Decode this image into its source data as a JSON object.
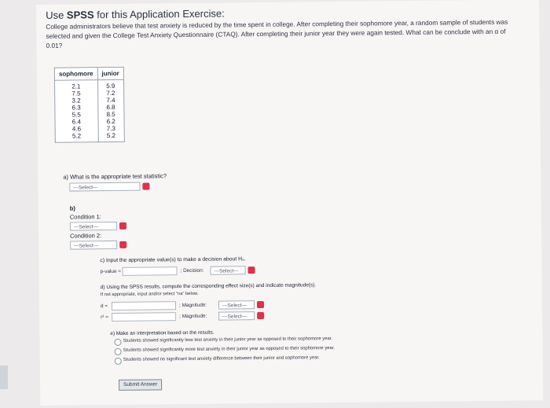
{
  "header": {
    "title_prefix": "Use",
    "title_strong": "SPSS",
    "title_suffix": " for this Application Exercise:"
  },
  "intro": "College administrators believe that test anxiety is reduced by the time spent in college. After completing their sophomore year, a random sample of students was selected and given the College Test Anxiety Questionnaire (CTAQ). After completing their junior year they were again tested. What can be conclude with an α of 0.01?",
  "table": {
    "headers": [
      "sophomore",
      "junior"
    ],
    "sophomore": [
      "2.1",
      "7.5",
      "3.2",
      "6.3",
      "5.5",
      "6.4",
      "4.6",
      "5.2"
    ],
    "junior": [
      "5.9",
      "7.2",
      "7.4",
      "6.8",
      "8.5",
      "6.2",
      "7.3",
      "5.2"
    ]
  },
  "qa": {
    "label": "a) What is the appropriate test statistic?",
    "select": "---Select---"
  },
  "qb": {
    "label": "b)",
    "cond1": "Condition 1:",
    "cond1_select": "---Select---",
    "cond2": "Condition 2:",
    "cond2_select": "---Select---"
  },
  "qc": {
    "label": "c) Input the appropriate value(s) to make a decision about H₀.",
    "pvalue": "p-value =",
    "decision": "; Decision:",
    "select": "---Select---"
  },
  "qd": {
    "label": "d) Using the SPSS results, compute the corresponding effect size(s) and indicate magnitude(s).",
    "note": "If not appropriate, input and/or select \"na\" below.",
    "d": "d =",
    "r2": "r² =",
    "mag1": "; Magnitude:",
    "mag2": "; Magnitude:",
    "select": "---Select---"
  },
  "qe": {
    "label": "e) Make an interpretation based on the results.",
    "opt1": "Students showed significantly less test anxiety in their junior year as opposed to their sophomore year.",
    "opt2": "Students showed significantly more test anxiety in their junior year as opposed to their sophomore year.",
    "opt3": "Students showed no significant test anxiety difference between their junior and sophomore year."
  },
  "submit": "Submit Answer",
  "colors": {
    "flag": "#e0304a"
  }
}
